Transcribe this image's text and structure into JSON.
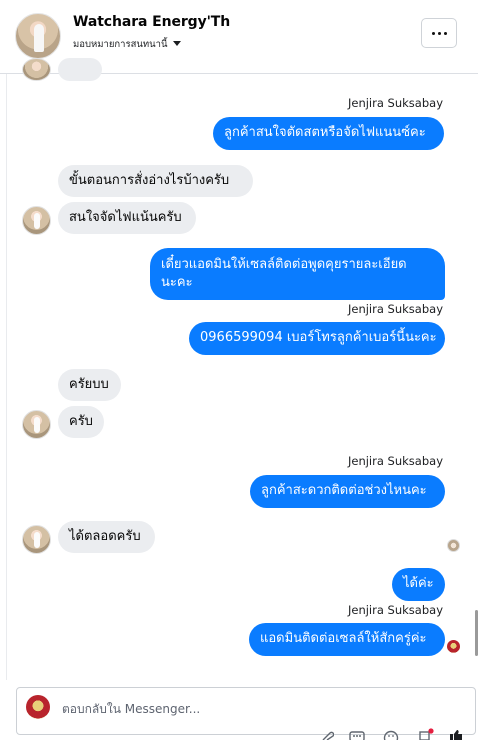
{
  "header": {
    "name": "Watchara Energy'Th",
    "subtitle": "มอบหมายการสนทนานี้",
    "more_label": "..."
  },
  "messages": {
    "sender_1": "Jenjira Suksabay",
    "out_1": "ลูกค้าสนใจตัดสตหรือจัดไฟแนนซ์คะ",
    "in_1": "ขั้นตอนการสั่งอ่างไรบ้างครับ",
    "in_2": "สนใจจัดไฟแน้นครับ",
    "out_2_line1": "เดี๋ยวแอดมินให้เซลล์ติดต่อพูดคุยรายละเอียด",
    "out_2_line2": "นะคะ",
    "sender_2": "Jenjira Suksabay",
    "out_3": "0966599094 เบอร์โทรลูกค้าเบอร์นี้นะคะ",
    "in_3": "ครัยบบ",
    "in_4": "ครับ",
    "sender_3": "Jenjira Suksabay",
    "out_4": "ลูกค้าสะดวกติดต่อช่วงไหนคะ",
    "in_5": "ได้ตลอดครับ",
    "out_5": "ได้ค่ะ",
    "sender_4": "Jenjira Suksabay",
    "out_6": "แอดมินติดต่อเซลล์ให้สักครู่ค่ะ"
  },
  "composer": {
    "placeholder": "ตอบกลับใน Messenger..."
  },
  "colors": {
    "outgoing": "#0a7cff",
    "incoming": "#ebedf0",
    "accent": "#0a7cff"
  }
}
